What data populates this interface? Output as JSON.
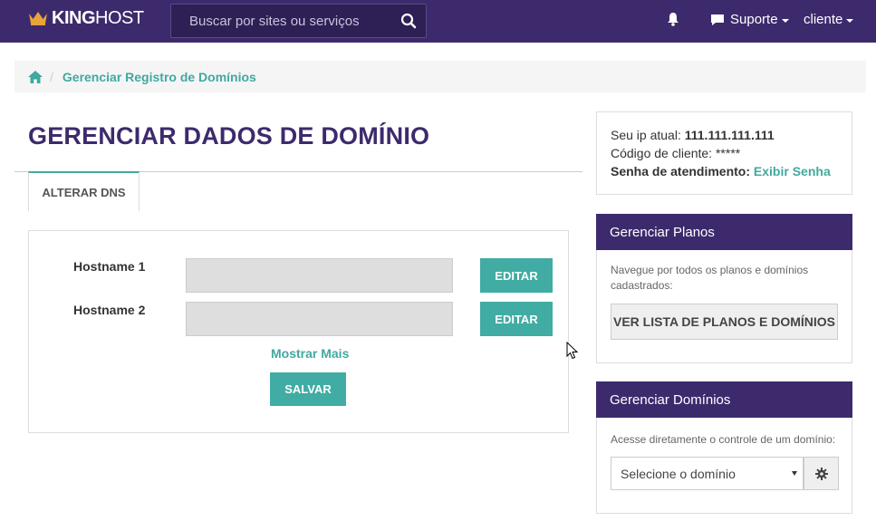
{
  "header": {
    "brand_king": "KING",
    "brand_host": "HOST",
    "search_placeholder": "Buscar por sites ou serviços",
    "support_label": "Suporte",
    "user_label": "cliente"
  },
  "breadcrumb": {
    "current": "Gerenciar Registro de Domínios"
  },
  "main": {
    "title": "GERENCIAR DADOS DE DOMÍNIO",
    "tab_label": "ALTERAR DNS",
    "hostnames": [
      {
        "label": "Hostname 1",
        "value": "",
        "button": "EDITAR"
      },
      {
        "label": "Hostname 2",
        "value": "",
        "button": "EDITAR"
      }
    ],
    "show_more": "Mostrar Mais",
    "save_label": "SALVAR"
  },
  "sidebar": {
    "ip_label": "Seu ip atual:",
    "ip_value": "111.111.111.111",
    "client_code_label": "Código de cliente:",
    "client_code_value": "*****",
    "password_label": "Senha de atendimento:",
    "password_link": "Exibir Senha",
    "plans": {
      "title": "Gerenciar Planos",
      "text": "Navegue por todos os planos e domínios cadastrados:",
      "button": "VER LISTA DE PLANOS E DOMÍNIOS"
    },
    "domains": {
      "title": "Gerenciar Domínios",
      "text": "Acesse diretamente o controle de um domínio:",
      "select_value": "Selecione o domínio"
    }
  },
  "colors": {
    "header_bg": "#3d2a6d",
    "accent": "#41aca3",
    "crown": "#e8a33a"
  }
}
